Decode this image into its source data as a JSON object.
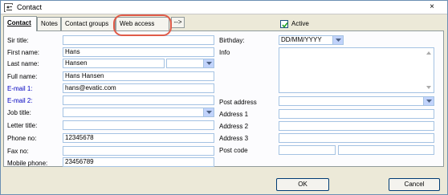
{
  "window": {
    "title": "Contact",
    "close_glyph": "×"
  },
  "tabs": [
    {
      "label": "Contact"
    },
    {
      "label": "Notes"
    },
    {
      "label": "Contact groups"
    },
    {
      "label": "Web access"
    }
  ],
  "tab_overflow_glyph": "-->",
  "active": {
    "label": "Active",
    "checked": true
  },
  "left_fields": {
    "sir_title": {
      "label": "Sir title:",
      "value": ""
    },
    "first_name": {
      "label": "First name:",
      "value": "Hans"
    },
    "last_name": {
      "label": "Last name:",
      "value": "Hansen"
    },
    "full_name": {
      "label": "Full name:",
      "value": "Hans Hansen"
    },
    "email1": {
      "label": "E-mail 1:",
      "value": "hans@evatic.com"
    },
    "email2": {
      "label": "E-mail 2:",
      "value": ""
    },
    "job_title": {
      "label": "Job title:",
      "value": ""
    },
    "letter_title": {
      "label": "Letter title:",
      "value": ""
    },
    "phone": {
      "label": "Phone no:",
      "value": "12345678"
    },
    "fax": {
      "label": "Fax no:",
      "value": ""
    },
    "mobile": {
      "label": "Mobile phone:",
      "value": "23456789"
    }
  },
  "right_fields": {
    "birthday": {
      "label": "Birthday:",
      "value": "DD/MM/YYYY"
    },
    "info": {
      "label": "Info",
      "value": ""
    },
    "post_address": {
      "label": "Post address",
      "value": ""
    },
    "address1": {
      "label": "Address 1",
      "value": ""
    },
    "address2": {
      "label": "Address 2",
      "value": ""
    },
    "address3": {
      "label": "Address 3",
      "value": ""
    },
    "post_code": {
      "label": "Post code",
      "value": ""
    }
  },
  "buttons": {
    "ok": "OK",
    "cancel": "Cancel"
  },
  "colors": {
    "highlight": "#e05b48",
    "link_label": "#0000c0"
  }
}
